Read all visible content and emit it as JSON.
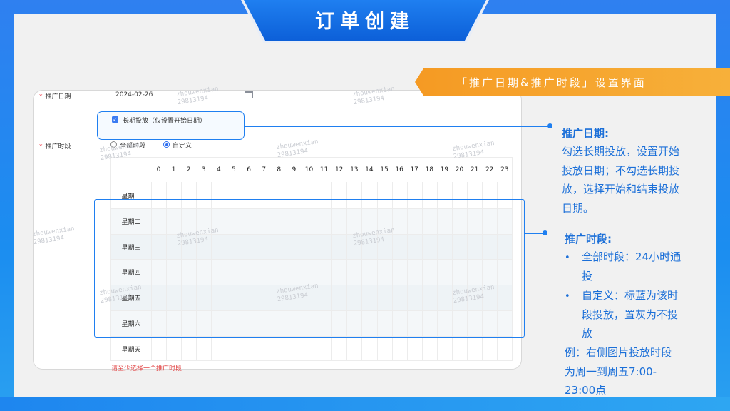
{
  "header": {
    "title": "订单创建"
  },
  "banner": {
    "text": "「推广日期&推广时段」设置界面"
  },
  "form": {
    "date_label": "推广日期",
    "date_value": "2024-02-26",
    "checkbox_label": "长期投放（仅设置开始日期）",
    "period_label": "推广时段",
    "radio_all": "全部时段",
    "radio_custom": "自定义",
    "hours": [
      "0",
      "1",
      "2",
      "3",
      "4",
      "5",
      "6",
      "7",
      "8",
      "9",
      "10",
      "11",
      "12",
      "13",
      "14",
      "15",
      "16",
      "17",
      "18",
      "19",
      "20",
      "21",
      "22",
      "23"
    ],
    "days": [
      "星期一",
      "星期二",
      "星期三",
      "星期四",
      "星期五",
      "星期六",
      "星期天"
    ],
    "error_hint": "请至少选择一个推广时段"
  },
  "watermark": {
    "line1": "zhouwenxian",
    "line2": "29813194"
  },
  "sidebar": {
    "date_title": "推广日期:",
    "date_lines": [
      "勾选长期投放，设置开始",
      "投放日期；不勾选长期投",
      "放，选择开始和结束投放",
      "日期。"
    ],
    "period_title": "推广时段:",
    "bullet1_lines": [
      "全部时段：24小时通",
      "投"
    ],
    "bullet2_lines": [
      "自定义：标蓝为该时",
      "段投放，置灰为不投",
      "放"
    ],
    "example_lines": [
      "例：右侧图片投放时段",
      "为周一到周五7:00-",
      "23:00点"
    ]
  },
  "colors": {
    "accent": "#1f7ff0",
    "orange": "#f59a23",
    "error": "#e24848"
  }
}
